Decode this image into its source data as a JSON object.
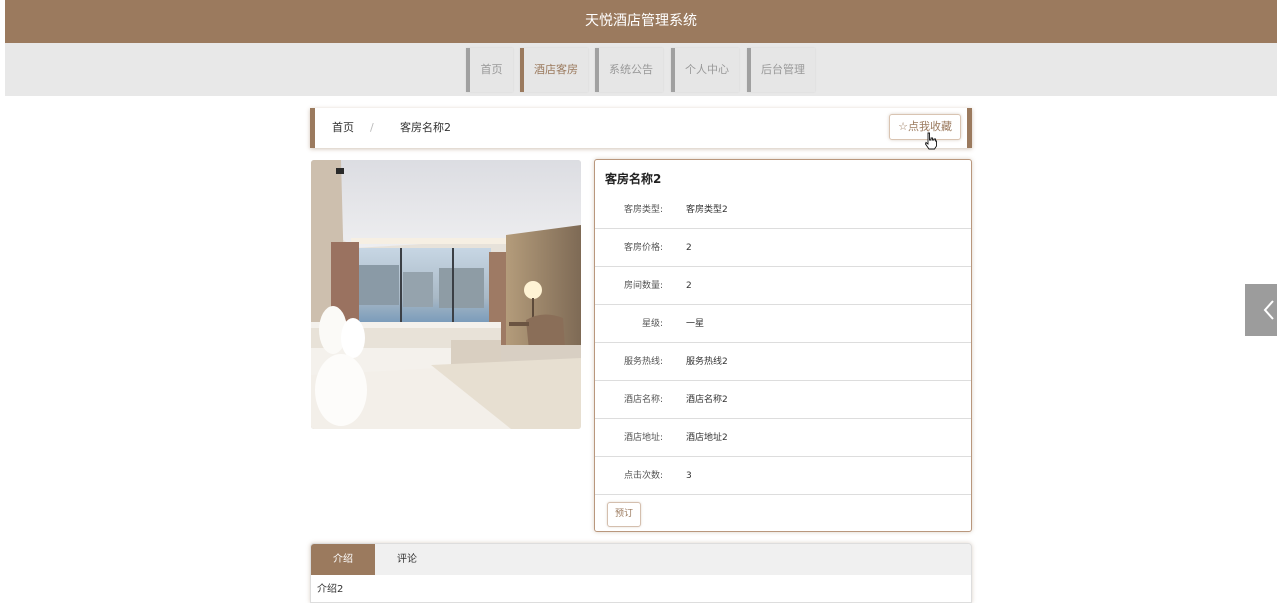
{
  "header": {
    "title": "天悦酒店管理系统"
  },
  "nav": {
    "items": [
      {
        "label": "首页"
      },
      {
        "label": "酒店客房"
      },
      {
        "label": "系统公告"
      },
      {
        "label": "个人中心"
      },
      {
        "label": "后台管理"
      }
    ],
    "active_index": 1
  },
  "breadcrumb": {
    "home": "首页",
    "separator": "/",
    "current": "客房名称2"
  },
  "favorite_button": {
    "icon": "star-outline-icon",
    "label": "点我收藏"
  },
  "room": {
    "title": "客房名称2",
    "fields": [
      {
        "label": "客房类型:",
        "value": "客房类型2"
      },
      {
        "label": "客房价格:",
        "value": "2"
      },
      {
        "label": "房间数量:",
        "value": "2"
      },
      {
        "label": "星级:",
        "value": "一星"
      },
      {
        "label": "服务热线:",
        "value": "服务热线2"
      },
      {
        "label": "酒店名称:",
        "value": "酒店名称2"
      },
      {
        "label": "酒店地址:",
        "value": "酒店地址2"
      },
      {
        "label": "点击次数:",
        "value": "3"
      }
    ],
    "book_button": "预订"
  },
  "tabs": {
    "items": [
      {
        "label": "介绍"
      },
      {
        "label": "评论"
      }
    ],
    "active_index": 0,
    "content": "介绍2"
  },
  "side_toggle": {
    "icon": "chevron-left-icon"
  },
  "colors": {
    "brand": "#9b7a5e",
    "nav_bg": "#e8e8e8"
  }
}
